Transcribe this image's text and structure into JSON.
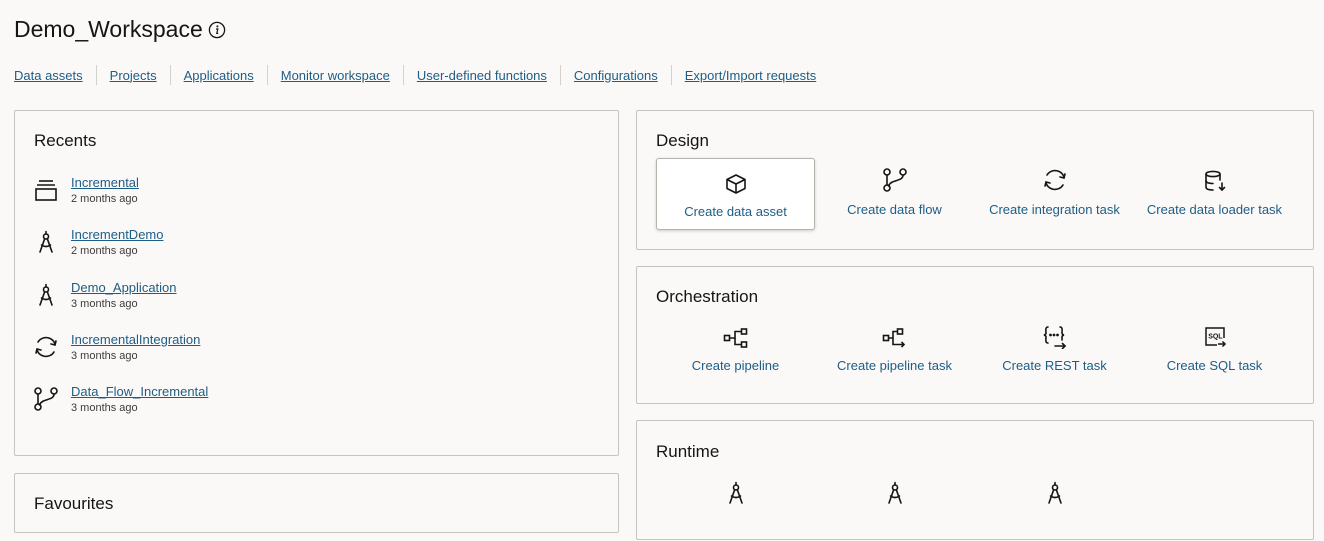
{
  "workspace": {
    "title": "Demo_Workspace"
  },
  "nav": {
    "links": [
      "Data assets",
      "Projects",
      "Applications",
      "Monitor workspace",
      "User-defined functions",
      "Configurations",
      "Export/Import requests"
    ]
  },
  "recents": {
    "title": "Recents",
    "items": [
      {
        "name": "Incremental",
        "time": "2 months ago",
        "icon": "data-loader-icon"
      },
      {
        "name": "IncrementDemo",
        "time": "2 months ago",
        "icon": "compass-icon"
      },
      {
        "name": "Demo_Application",
        "time": "3 months ago",
        "icon": "compass-icon"
      },
      {
        "name": "IncrementalIntegration",
        "time": "3 months ago",
        "icon": "sync-icon"
      },
      {
        "name": "Data_Flow_Incremental",
        "time": "3 months ago",
        "icon": "data-flow-icon"
      }
    ]
  },
  "favourites": {
    "title": "Favourites"
  },
  "design": {
    "title": "Design",
    "tiles": [
      {
        "label": "Create data asset",
        "icon": "cube-icon"
      },
      {
        "label": "Create data flow",
        "icon": "data-flow-icon"
      },
      {
        "label": "Create integration task",
        "icon": "sync-icon"
      },
      {
        "label": "Create data loader task",
        "icon": "database-download-icon"
      }
    ]
  },
  "orchestration": {
    "title": "Orchestration",
    "tiles": [
      {
        "label": "Create pipeline",
        "icon": "pipeline-icon"
      },
      {
        "label": "Create pipeline task",
        "icon": "pipeline-task-icon"
      },
      {
        "label": "Create REST task",
        "icon": "rest-icon"
      },
      {
        "label": "Create SQL task",
        "icon": "sql-icon"
      }
    ]
  },
  "runtime": {
    "title": "Runtime",
    "icons": [
      "compass-icon",
      "compass-icon",
      "compass-icon"
    ]
  }
}
